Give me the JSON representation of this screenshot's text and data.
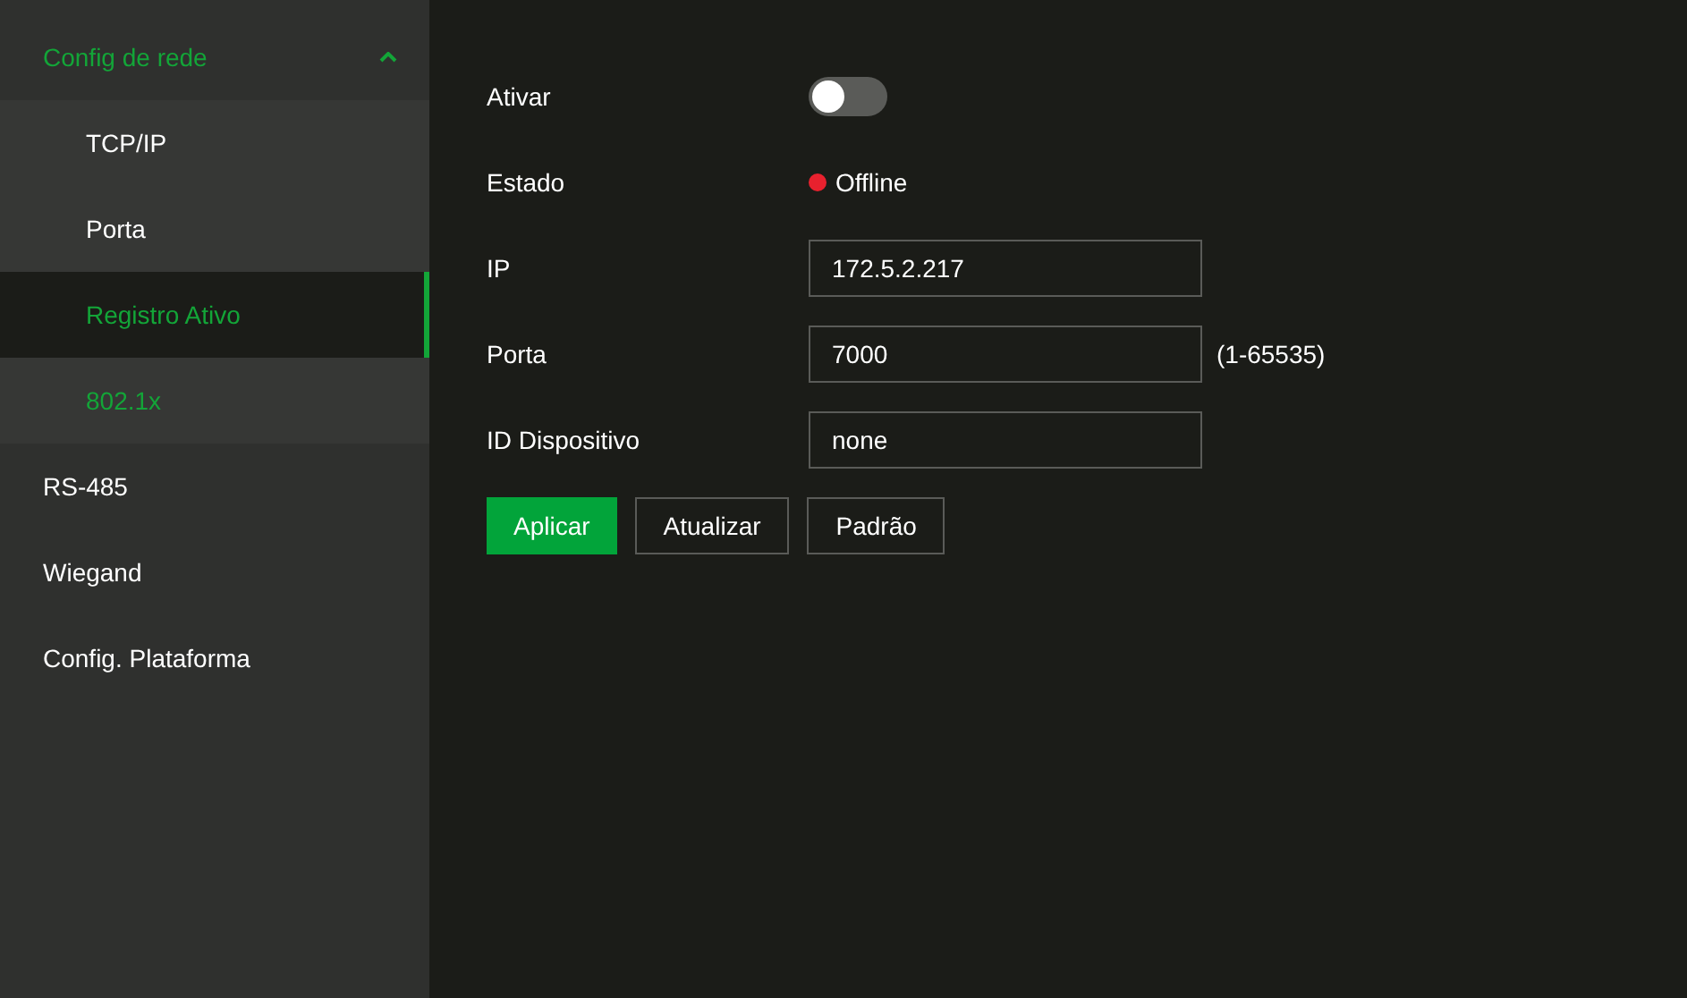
{
  "sidebar": {
    "items": [
      {
        "label": "Config de rede",
        "selected": false,
        "expanded": true,
        "children": [
          {
            "label": "TCP/IP",
            "selected": false
          },
          {
            "label": "Porta",
            "selected": false
          },
          {
            "label": "Registro Ativo",
            "selected": true
          },
          {
            "label": "802.1x",
            "selected": false,
            "hovered": true
          }
        ]
      },
      {
        "label": "RS-485",
        "selected": false
      },
      {
        "label": "Wiegand",
        "selected": false
      },
      {
        "label": "Config. Plataforma",
        "selected": false
      }
    ]
  },
  "form": {
    "fields": [
      {
        "kind": "toggle",
        "label": "Ativar",
        "on": false
      },
      {
        "kind": "status",
        "label": "Estado",
        "value": "Offline",
        "color": "#e8212e"
      },
      {
        "kind": "input",
        "label": "IP",
        "value": "172.5.2.217"
      },
      {
        "kind": "input",
        "label": "Porta",
        "value": "7000",
        "hint": "(1-65535)"
      },
      {
        "kind": "input",
        "label": "ID Dispositivo",
        "value": "none"
      }
    ],
    "buttons": [
      {
        "label": "Aplicar",
        "kind": "primary"
      },
      {
        "label": "Atualizar",
        "kind": "secondary"
      },
      {
        "label": "Padrão",
        "kind": "secondary"
      }
    ]
  }
}
